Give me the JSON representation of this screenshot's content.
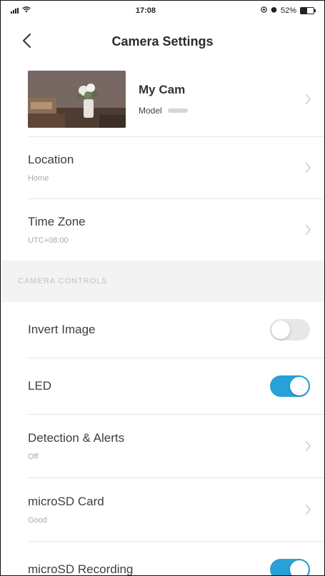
{
  "status_bar": {
    "time": "17:08",
    "battery": "52%",
    "battery_level": 0.52
  },
  "header": {
    "title": "Camera Settings"
  },
  "device": {
    "name": "My Cam",
    "model_label": "Model"
  },
  "rows": {
    "location": {
      "label": "Location",
      "value": "Home"
    },
    "time_zone": {
      "label": "Time Zone",
      "value": "UTC+08:00"
    }
  },
  "section": {
    "camera_controls": "CAMERA CONTROLS"
  },
  "controls": {
    "invert_image": {
      "label": "Invert Image",
      "on": false
    },
    "led": {
      "label": "LED",
      "on": true
    },
    "detection": {
      "label": "Detection & Alerts",
      "value": "Off"
    },
    "microsd_card": {
      "label": "microSD Card",
      "value": "Good"
    },
    "microsd_recording": {
      "label": "microSD Recording",
      "on": true
    }
  },
  "colors": {
    "toggle_on": "#28a0d8",
    "toggle_off": "#e7e7e7"
  }
}
